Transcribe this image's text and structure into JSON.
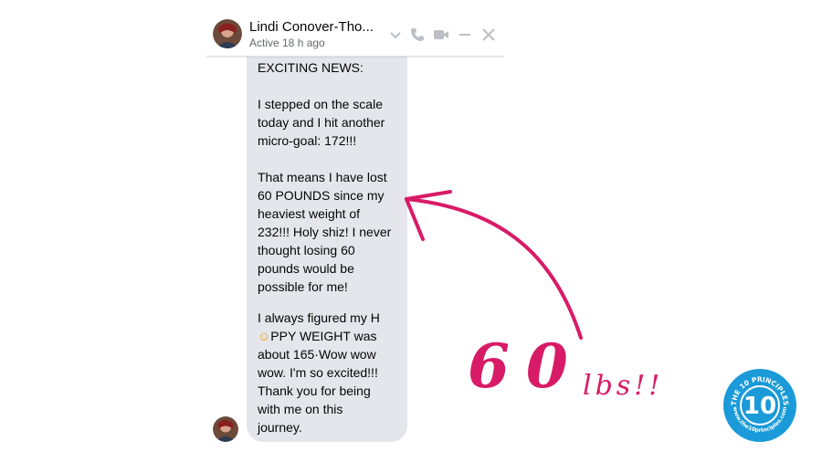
{
  "chat": {
    "contact_name": "Lindi Conover-Tho...",
    "status": "Active 18 h ago",
    "message_lines": [
      "EXCITING NEWS:",
      "I stepped on the scale",
      "today and I hit another",
      "micro-goal: 172!!!",
      "That means I have lost",
      "60 POUNDS since my",
      "heaviest weight of",
      "232!!! Holy shiz! I never",
      "thought losing 60",
      "pounds would be",
      "possible for me!",
      "I always figured my H",
      "PPY WEIGHT was",
      "about 165·Wow wow",
      "wow. I'm so excited!!!",
      "Thank you for being",
      "with me on this",
      "journey."
    ],
    "emoji": "☺"
  },
  "icons": [
    "chevron-down-icon",
    "phone-icon",
    "video-icon",
    "minimize-icon",
    "close-icon"
  ],
  "annotation": {
    "big_text": "60",
    "small_text": "lbs!!",
    "color": "#d81b66"
  },
  "logo": {
    "top_text": "THE 10 PRINCIPLES",
    "number": "10",
    "bottom_text": "www.the10principles.com",
    "color": "#1a9ad8"
  }
}
